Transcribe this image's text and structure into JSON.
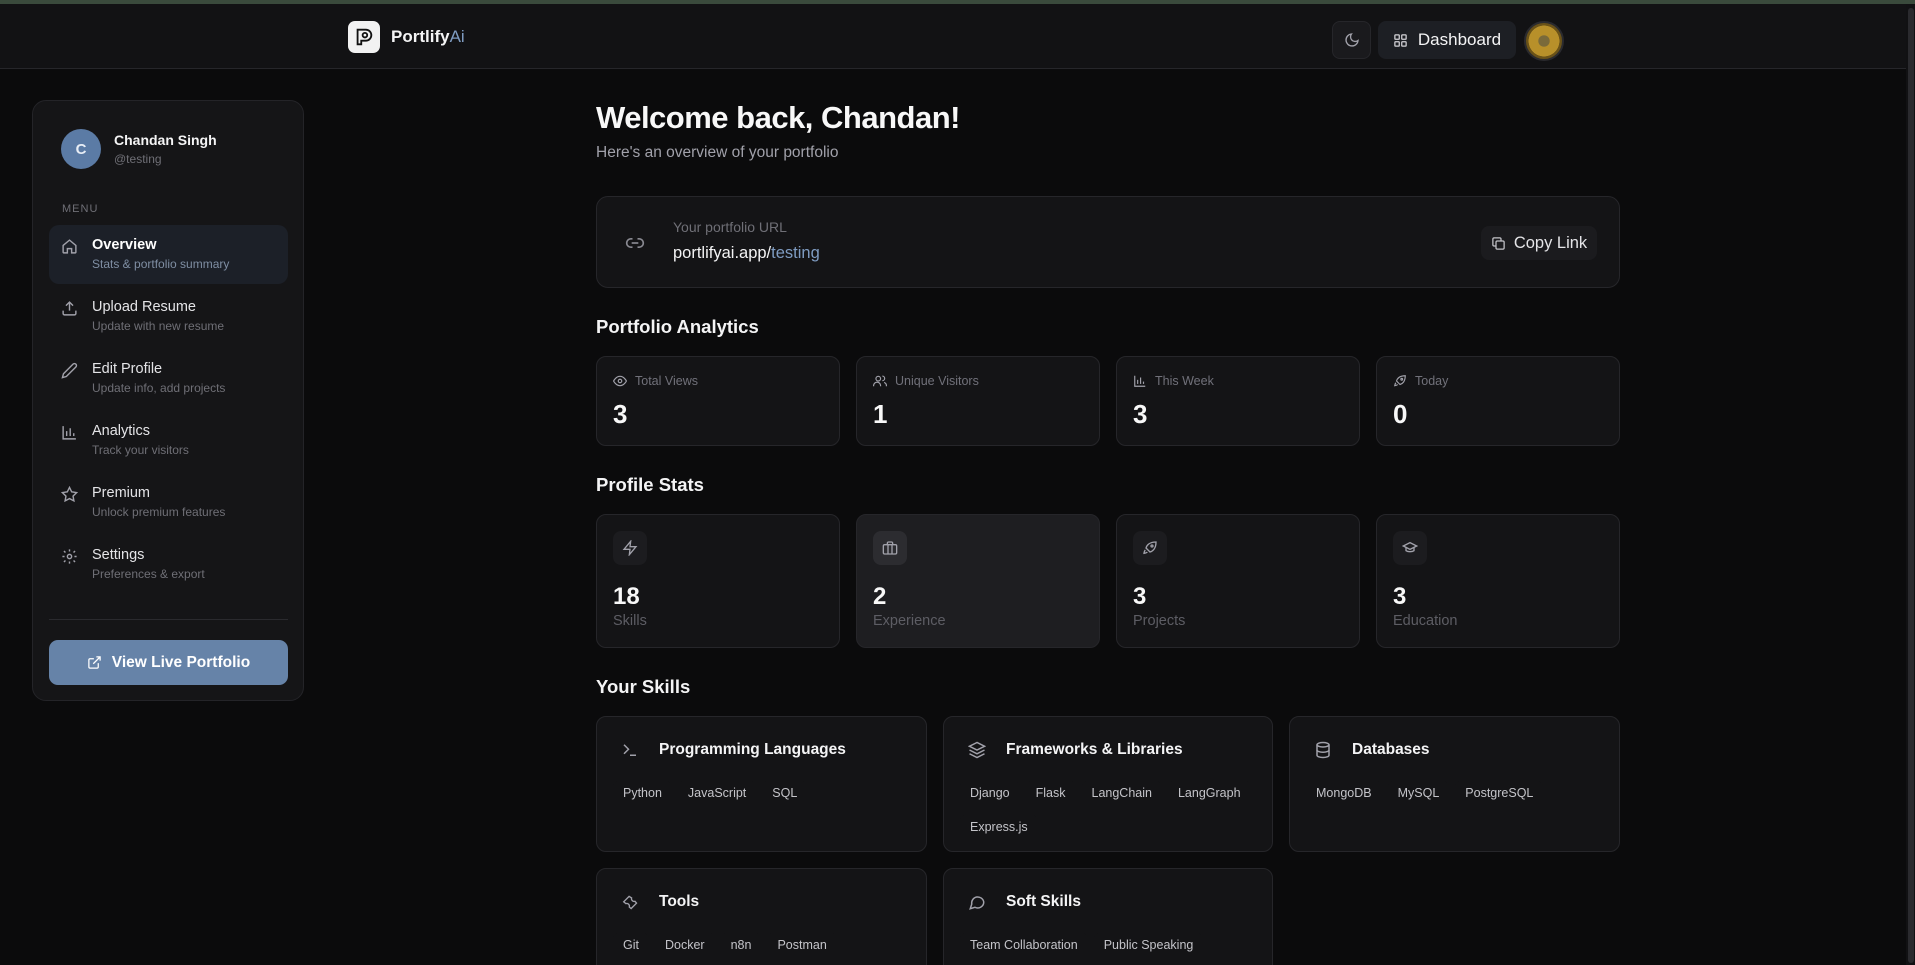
{
  "brand": {
    "name": "Portlify",
    "accent": "Ai"
  },
  "topnav": {
    "dashboard_label": "Dashboard"
  },
  "user": {
    "initial": "C",
    "name": "Chandan Singh",
    "handle": "@testing"
  },
  "sidebar": {
    "menu_label": "MENU",
    "items": [
      {
        "title": "Overview",
        "subtitle": "Stats & portfolio summary",
        "icon": "home-icon",
        "active": true
      },
      {
        "title": "Upload Resume",
        "subtitle": "Update with new resume",
        "icon": "upload-icon"
      },
      {
        "title": "Edit Profile",
        "subtitle": "Update info, add projects",
        "icon": "pencil-icon"
      },
      {
        "title": "Analytics",
        "subtitle": "Track your visitors",
        "icon": "bar-chart-icon"
      },
      {
        "title": "Premium",
        "subtitle": "Unlock premium features",
        "icon": "star-icon"
      },
      {
        "title": "Settings",
        "subtitle": "Preferences & export",
        "icon": "gear-icon"
      }
    ],
    "live_button": "View Live Portfolio"
  },
  "main": {
    "welcome": "Welcome back, Chandan!",
    "welcome_sub": "Here's an overview of your portfolio",
    "url_card": {
      "label": "Your portfolio URL",
      "base": "portlifyai.app/",
      "slug": "testing",
      "copy_label": "Copy Link"
    },
    "analytics_title": "Portfolio Analytics",
    "analytics": [
      {
        "label": "Total Views",
        "value": "3",
        "icon": "eye-icon"
      },
      {
        "label": "Unique Visitors",
        "value": "1",
        "icon": "users-icon"
      },
      {
        "label": "This Week",
        "value": "3",
        "icon": "bar-chart-icon"
      },
      {
        "label": "Today",
        "value": "0",
        "icon": "rocket-icon"
      }
    ],
    "profile_title": "Profile Stats",
    "profile_stats": [
      {
        "label": "Skills",
        "value": "18",
        "icon": "zap-icon"
      },
      {
        "label": "Experience",
        "value": "2",
        "icon": "briefcase-icon"
      },
      {
        "label": "Projects",
        "value": "3",
        "icon": "rocket-icon"
      },
      {
        "label": "Education",
        "value": "3",
        "icon": "graduation-cap-icon"
      }
    ],
    "skills_title": "Your Skills",
    "skill_groups": [
      {
        "title": "Programming Languages",
        "icon": "terminal-icon",
        "tags": [
          "Python",
          "JavaScript",
          "SQL"
        ]
      },
      {
        "title": "Frameworks & Libraries",
        "icon": "layers-icon",
        "tags": [
          "Django",
          "Flask",
          "LangChain",
          "LangGraph",
          "Express.js"
        ]
      },
      {
        "title": "Databases",
        "icon": "database-icon",
        "tags": [
          "MongoDB",
          "MySQL",
          "PostgreSQL"
        ]
      },
      {
        "title": "Tools",
        "icon": "wrench-icon",
        "tags": [
          "Git",
          "Docker",
          "n8n",
          "Postman"
        ]
      },
      {
        "title": "Soft Skills",
        "icon": "chat-bubble-icon",
        "tags": [
          "Team Collaboration",
          "Public Speaking"
        ]
      }
    ]
  },
  "colors": {
    "accent": "#6683a8",
    "link": "#7f9cc2",
    "background": "#0b0b0c",
    "card": "#141416"
  }
}
